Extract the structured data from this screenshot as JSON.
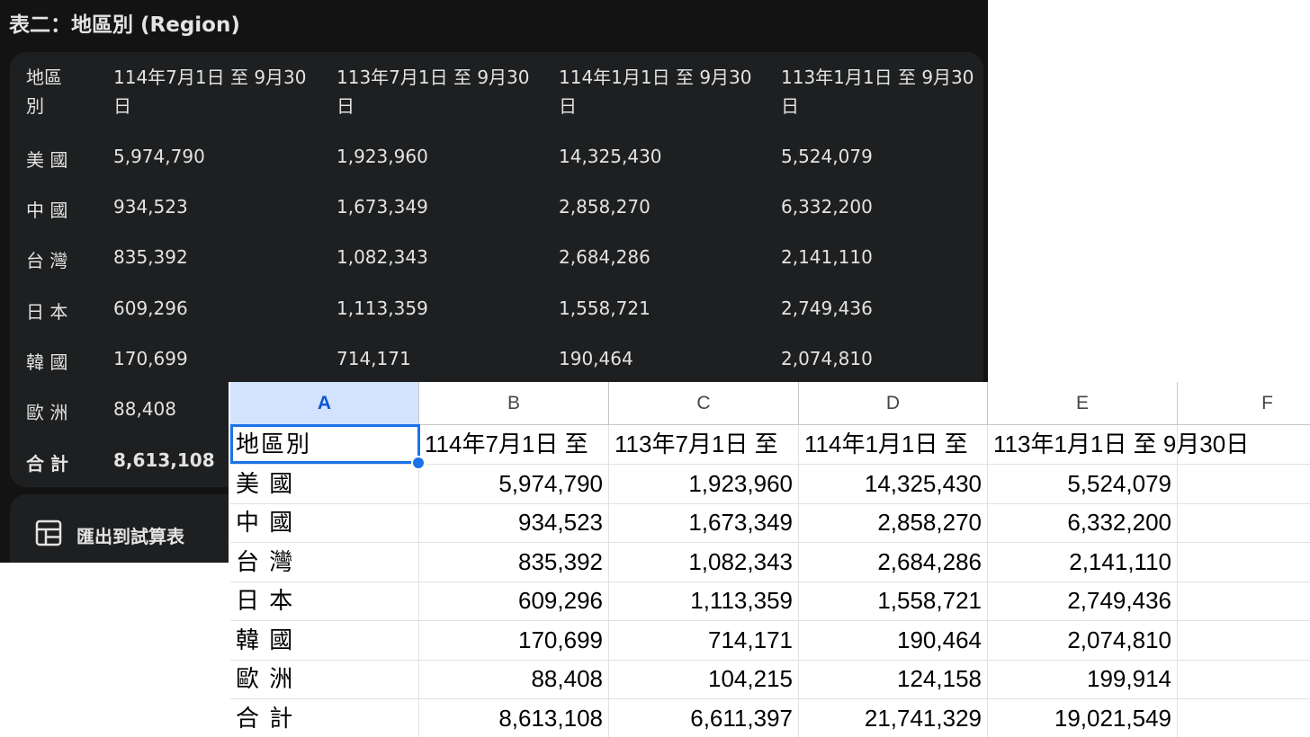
{
  "dark_table": {
    "title": "表二：地區別 (Region)",
    "headers": [
      "地區\n別",
      "114年7月1日 至 9月30\n日",
      "113年7月1日 至 9月30\n日",
      "114年1月1日 至 9月30\n日",
      "113年1月1日 至 9月30\n日"
    ],
    "rows": [
      [
        "美 國",
        "5,974,790",
        "1,923,960",
        "14,325,430",
        "5,524,079"
      ],
      [
        "中 國",
        "934,523",
        "1,673,349",
        "2,858,270",
        "6,332,200"
      ],
      [
        "台 灣",
        "835,392",
        "1,082,343",
        "2,684,286",
        "2,141,110"
      ],
      [
        "日 本",
        "609,296",
        "1,113,359",
        "1,558,721",
        "2,749,436"
      ],
      [
        "韓 國",
        "170,699",
        "714,171",
        "190,464",
        "2,074,810"
      ],
      [
        "歐 洲",
        "88,408",
        "",
        "",
        ""
      ],
      [
        "合 計",
        "8,613,108",
        "",
        "",
        ""
      ]
    ],
    "export_label": "匯出到試算表",
    "export_icon": "table-grid-icon"
  },
  "spreadsheet": {
    "columns": [
      "A",
      "B",
      "C",
      "D",
      "E",
      "F"
    ],
    "selected_column": "A",
    "selected_cell": "A1",
    "header_row": [
      "地區別",
      "114年7月1日 至",
      "113年7月1日 至",
      "114年1月1日 至",
      "113年1月1日 至 9月30日",
      ""
    ],
    "rows": [
      [
        "美 國",
        "5,974,790",
        "1,923,960",
        "14,325,430",
        "5,524,079"
      ],
      [
        "中 國",
        "934,523",
        "1,673,349",
        "2,858,270",
        "6,332,200"
      ],
      [
        "台 灣",
        "835,392",
        "1,082,343",
        "2,684,286",
        "2,141,110"
      ],
      [
        "日 本",
        "609,296",
        "1,113,359",
        "1,558,721",
        "2,749,436"
      ],
      [
        "韓 國",
        "170,699",
        "714,171",
        "190,464",
        "2,074,810"
      ],
      [
        "歐 洲",
        "88,408",
        "104,215",
        "124,158",
        "199,914"
      ],
      [
        "合 計",
        "8,613,108",
        "6,611,397",
        "21,741,329",
        "19,021,549"
      ]
    ],
    "colors": {
      "selection": "#1a73e8",
      "selected_header_bg": "#d3e3fd"
    }
  }
}
